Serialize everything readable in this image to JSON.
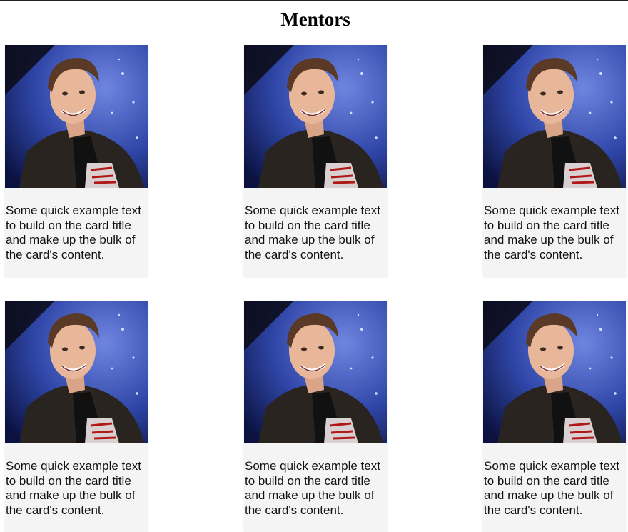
{
  "page": {
    "title": "Mentors"
  },
  "cards": [
    {
      "image": "mentor-photo",
      "text": "Some quick example text to build on the card title and make up the bulk of the card's content."
    },
    {
      "image": "mentor-photo",
      "text": "Some quick example text to build on the card title and make up the bulk of the card's content."
    },
    {
      "image": "mentor-photo",
      "text": "Some quick example text to build on the card title and make up the bulk of the card's content."
    },
    {
      "image": "mentor-photo",
      "text": "Some quick example text to build on the card title and make up the bulk of the card's content."
    },
    {
      "image": "mentor-photo",
      "text": "Some quick example text to build on the card title and make up the bulk of the card's content."
    },
    {
      "image": "mentor-photo",
      "text": "Some quick example text to build on the card title and make up the bulk of the card's content."
    }
  ],
  "colors": {
    "card_background": "#f4f4f4",
    "photo_background": "#2a3b8f",
    "jacket": "#2c2622",
    "skin": "#e7b79b",
    "hair": "#5a3a27"
  }
}
